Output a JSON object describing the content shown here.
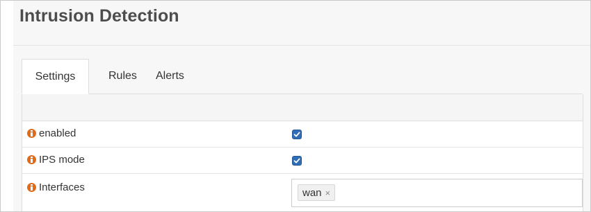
{
  "page": {
    "title": "Intrusion Detection"
  },
  "tabs": [
    {
      "label": "Settings",
      "active": true
    },
    {
      "label": "Rules",
      "active": false
    },
    {
      "label": "Alerts",
      "active": false
    }
  ],
  "settings": {
    "rows": [
      {
        "label": "enabled",
        "icon": "info-icon",
        "type": "checkbox",
        "checked": true
      },
      {
        "label": "IPS mode",
        "icon": "info-icon",
        "type": "checkbox",
        "checked": true
      },
      {
        "label": "Interfaces",
        "icon": "info-icon",
        "type": "tags",
        "tags": [
          {
            "label": "wan",
            "remove_glyph": "×"
          }
        ]
      }
    ]
  },
  "colors": {
    "info_icon": "#e06b18",
    "checkbox_checked": "#2f6db5"
  }
}
